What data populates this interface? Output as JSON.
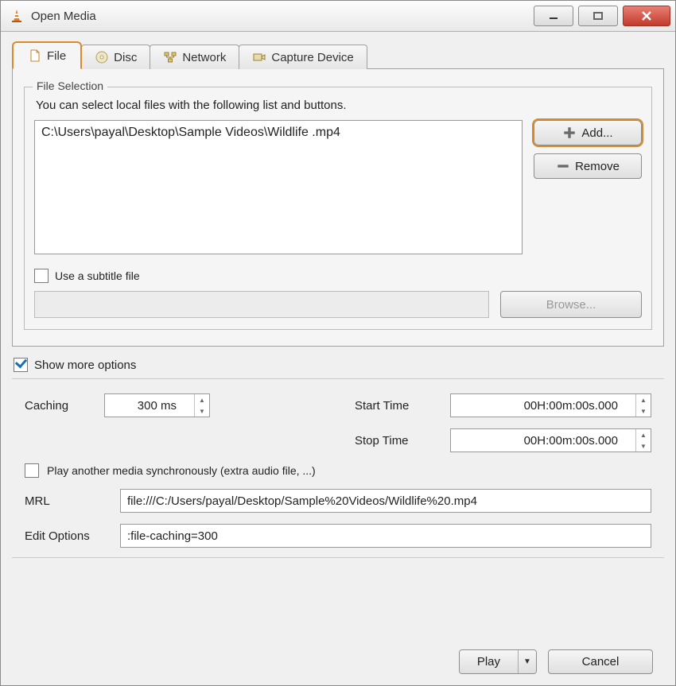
{
  "window": {
    "title": "Open Media"
  },
  "win_controls": {
    "minimize": "minimize",
    "maximize": "maximize",
    "close": "close"
  },
  "tabs": {
    "file": "File",
    "disc": "Disc",
    "network": "Network",
    "capture": "Capture Device"
  },
  "file_section": {
    "legend": "File Selection",
    "hint": "You can select local files with the following list and buttons.",
    "items": [
      "C:\\Users\\payal\\Desktop\\Sample Videos\\Wildlife .mp4"
    ],
    "add_label": "Add...",
    "remove_label": "Remove"
  },
  "subtitle": {
    "checkbox_label": "Use a subtitle file",
    "browse_label": "Browse..."
  },
  "show_more_label": "Show more options",
  "options": {
    "caching_label": "Caching",
    "caching_value": "300 ms",
    "start_time_label": "Start Time",
    "start_time_value": "00H:00m:00s.000",
    "stop_time_label": "Stop Time",
    "stop_time_value": "00H:00m:00s.000",
    "play_another_label": "Play another media synchronously (extra audio file, ...)",
    "mrl_label": "MRL",
    "mrl_value": "file:///C:/Users/payal/Desktop/Sample%20Videos/Wildlife%20.mp4",
    "edit_options_label": "Edit Options",
    "edit_options_value": ":file-caching=300"
  },
  "footer": {
    "play_label": "Play",
    "cancel_label": "Cancel"
  }
}
